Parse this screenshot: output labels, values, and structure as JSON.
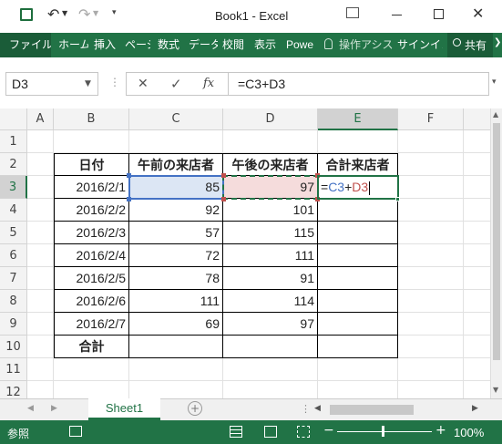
{
  "app": {
    "title": "Book1 - Excel"
  },
  "ribbon_tabs": [
    "ファイル",
    "ホーム",
    "挿入",
    "ページ",
    "数式",
    "データ",
    "校閲",
    "表示",
    "Powe"
  ],
  "tell_me": "操作アシス",
  "signin": "サインイン",
  "share": "共有",
  "formula_bar": {
    "name_box": "D3",
    "cancel": "✕",
    "enter": "✓",
    "fx": "fx",
    "formula": "=C3+D3"
  },
  "columns": [
    "A",
    "B",
    "C",
    "D",
    "E",
    "F"
  ],
  "rows": [
    "1",
    "2",
    "3",
    "4",
    "5",
    "6",
    "7",
    "8",
    "9",
    "10",
    "11",
    "12"
  ],
  "table": {
    "headers": [
      "日付",
      "午前の来店者",
      "午後の来店者",
      "合計来店者"
    ],
    "rows": [
      {
        "date": "2016/2/1",
        "am": "85",
        "pm": "97"
      },
      {
        "date": "2016/2/2",
        "am": "92",
        "pm": "101"
      },
      {
        "date": "2016/2/3",
        "am": "57",
        "pm": "115"
      },
      {
        "date": "2016/2/4",
        "am": "72",
        "pm": "111"
      },
      {
        "date": "2016/2/5",
        "am": "78",
        "pm": "91"
      },
      {
        "date": "2016/2/6",
        "am": "111",
        "pm": "114"
      },
      {
        "date": "2016/2/7",
        "am": "69",
        "pm": "97"
      }
    ],
    "total_label": "合計",
    "edit_formula": {
      "eq": "=",
      "c3": "C3",
      "plus": "+",
      "d3": "D3"
    }
  },
  "sheet_tab": "Sheet1",
  "status": {
    "mode": "参照",
    "zoom": "100%"
  },
  "colors": {
    "excel_green": "#217346",
    "ref_blue": "#4472c4",
    "ref_red": "#c0504d"
  }
}
